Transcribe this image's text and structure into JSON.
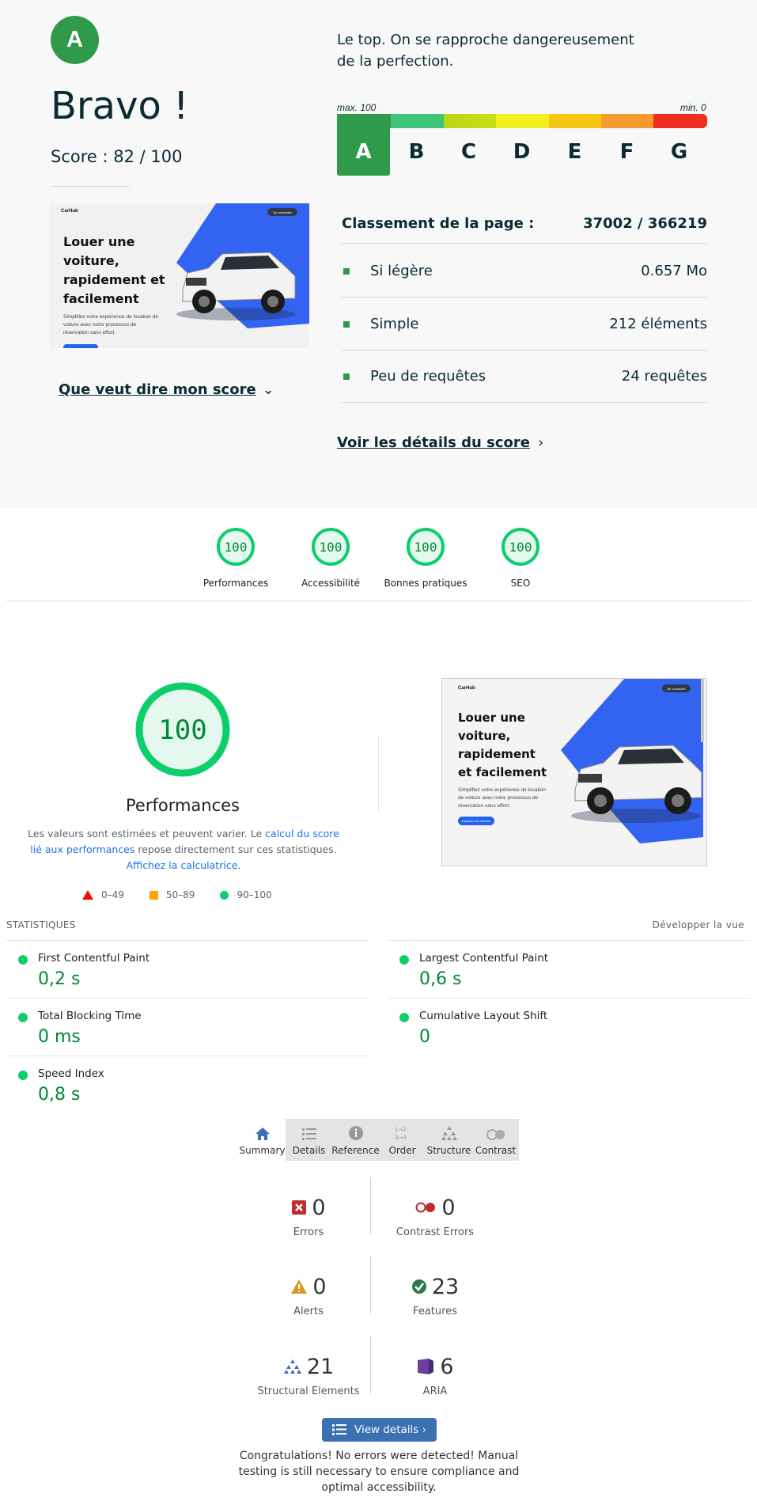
{
  "ecoindex": {
    "grade": "A",
    "headline": "Bravo !",
    "score_text": "Score : 82 / 100",
    "description": "Le top. On se rapproche dangereusement de la perfection.",
    "scale_max": "max. 100",
    "scale_min": "min. 0",
    "grades": [
      "A",
      "B",
      "C",
      "D",
      "E",
      "F",
      "G"
    ],
    "active_grade": "A",
    "rank_label": "Classement de la page :",
    "rank_value": "37002 / 366219",
    "metrics": [
      {
        "label": "Si légère",
        "value": "0.657 Mo"
      },
      {
        "label": "Simple",
        "value": "212 éléments"
      },
      {
        "label": "Peu de requêtes",
        "value": "24 requêtes"
      }
    ],
    "score_meaning_link": "Que veut dire mon score",
    "details_link": "Voir les détails du score",
    "colors": {
      "grade_green": "#2f9a4a",
      "text": "#0b2a35"
    }
  },
  "preview": {
    "logo": "CarHub",
    "button": "Se connecter",
    "heading": "Louer une voiture, rapidement et facilement",
    "subtitle": "Simplifiez votre expérience de location de voiture avec notre processus de réservation sans effort.",
    "cta": "Explorer les voitures"
  },
  "lighthouse": {
    "categories": [
      {
        "label": "Performances",
        "score": "100"
      },
      {
        "label": "Accessibilité",
        "score": "100"
      },
      {
        "label": "Bonnes pratiques",
        "score": "100"
      },
      {
        "label": "SEO",
        "score": "100"
      }
    ],
    "performance_score": "100",
    "performance_title": "Performances",
    "note_part1": "Les valeurs sont estimées et peuvent varier. Le ",
    "note_link1": "calcul du score lié aux performances",
    "note_part2": " repose directement sur ces statistiques. ",
    "note_link2": "Affichez la calculatrice",
    "note_part3": ".",
    "legend": [
      "0–49",
      "50–89",
      "90–100"
    ],
    "stats_header": "STATISTIQUES",
    "expand_view": "Développer la vue",
    "metrics": [
      {
        "name": "First Contentful Paint",
        "value": "0,2 s"
      },
      {
        "name": "Largest Contentful Paint",
        "value": "0,6 s"
      },
      {
        "name": "Total Blocking Time",
        "value": "0 ms"
      },
      {
        "name": "Cumulative Layout Shift",
        "value": "0"
      },
      {
        "name": "Speed Index",
        "value": "0,8 s"
      }
    ],
    "colors": {
      "pass": "#0cce6b",
      "pass_text": "#008a35",
      "average": "#ffa400",
      "fail": "#eb0f00"
    }
  },
  "wave": {
    "tabs": [
      "Summary",
      "Details",
      "Reference",
      "Order",
      "Structure",
      "Contrast"
    ],
    "active_tab": "Summary",
    "stats": [
      {
        "label": "Errors",
        "count": "0",
        "icon": "error-icon"
      },
      {
        "label": "Contrast Errors",
        "count": "0",
        "icon": "contrast-error-icon"
      },
      {
        "label": "Alerts",
        "count": "0",
        "icon": "alert-icon"
      },
      {
        "label": "Features",
        "count": "23",
        "icon": "feature-check-icon"
      },
      {
        "label": "Structural Elements",
        "count": "21",
        "icon": "structure-icon"
      },
      {
        "label": "ARIA",
        "count": "6",
        "icon": "aria-icon"
      }
    ],
    "view_details": "View details ›",
    "congrats": "Congratulations! No errors were detected! Manual testing is still necessary to ensure compliance and optimal accessibility."
  }
}
